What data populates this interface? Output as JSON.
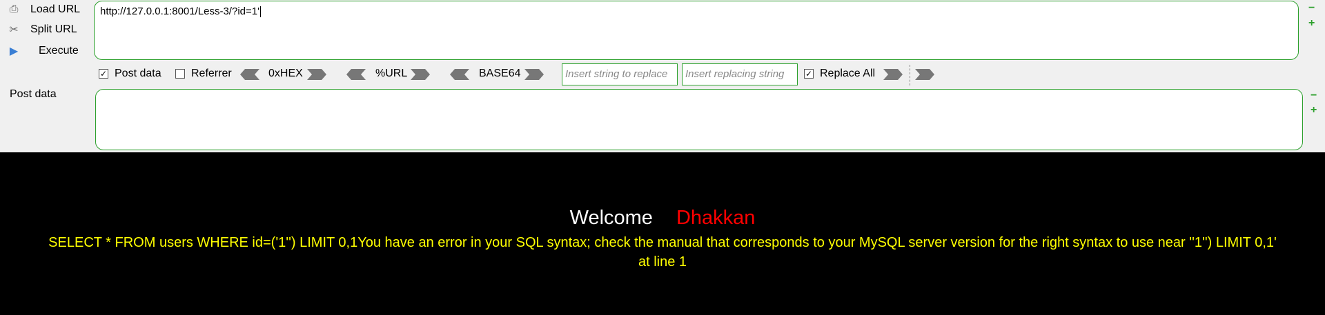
{
  "toolbar": {
    "load_url": "Load URL",
    "split_url": "Split URL",
    "execute": "Execute",
    "url_value": "http://127.0.0.1:8001/Less-3/?id=1'",
    "post_data_check": "Post data",
    "referrer_check": "Referrer",
    "hex": "0xHEX",
    "url_enc": "%URL",
    "base64": "BASE64",
    "insert_placeholder": "Insert string to replace",
    "replacing_placeholder": "Insert replacing string",
    "replace_all": "Replace All",
    "post_data_label": "Post data",
    "post_data_checked": true,
    "referrer_checked": false,
    "replace_all_checked": true
  },
  "page": {
    "welcome": "Welcome",
    "user": "Dhakkan",
    "error_line1": "SELECT * FROM users WHERE id=('1'') LIMIT 0,1You have an error in your SQL syntax; check the manual that corresponds to your MySQL server version for the right syntax to use near ''1'') LIMIT 0,1'",
    "error_line2": "at line 1"
  },
  "colors": {
    "accent": "#2ca02c",
    "welcome": "#ffffff",
    "user": "#ff0000",
    "error": "#ffff00"
  }
}
